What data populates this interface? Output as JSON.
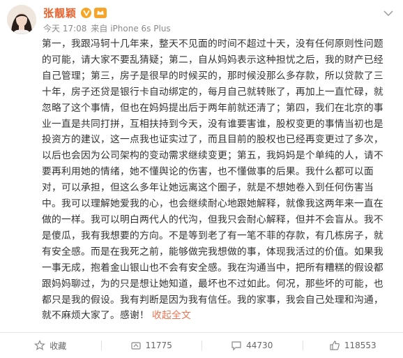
{
  "post": {
    "author": "张靓颖",
    "timestamp": "今天 17:08",
    "source": "来自 iPhone 6s Plus",
    "text": "第一，我跟冯轲十几年来，整天不见面的时间不超过十天，没有任何原则性问题的可能，请大家不要乱猜疑；第二，自从妈妈表示这种担忧之后，我的财产已经自己管理；第三，房子是很早的时候买的，那时候没那么多存款，所以贷款了三十年，房子还贷是银行卡自动绑定的，每月自己就转账了，再加上一直忙碌，就忽略了这个事情，但也在妈妈提出后于两年前就还清了；第四，我们在北京的事业一直是共同打拼，互相扶持到今天，没有谁要害谁，股权变更的事情当初也是投资方的建议，这一点我也证实过了，而且目前的股权也已经再变更过了多次，以后也会因为公司架构的变动需求继续变更；第五，我妈妈是个单纯的人，请不要再利用她的情绪，她不懂舆论的伤害，也不懂做事的后果。我什么都可以面对，可以承担，但这么多年让她远离这个圈子，就是不想她卷入到任何伤害当中。我可以理解她爱我的心，也会继续耐心地跟她解释，就像我这两年来一直在做的一样。我可以明白两代人的代沟，但我只会耐心解释，但并不会盲从。我不是傻瓜，我有我想要的方向。不是等到老了有一笔不菲的存款，有几栋房子，就有安全感。而是在我死之前，能够做完我想做的事，体现我活过的价值。如果我一事无成，抱着金山银山也不会有安全感。我在沟通当中，把所有糟糕的假设都跟妈妈聊过，为的只是想让她知道，最坏也不过如此。何况，那些坏的可能，也都只是我的假设。我有判断是因为我有信任。我的家事，我会自己处理和沟通，就不麻烦大家了。感谢！",
    "collapse_label": "收起全文"
  },
  "actions": {
    "favorite_label": "收藏",
    "repost_count": "11775",
    "comment_count": "44730",
    "like_count": "118553"
  },
  "colors": {
    "name": "#e8612c",
    "link": "#eb7350",
    "meta": "#8a8a8a",
    "vip": "#f6a623"
  },
  "icons": {
    "verified": "vip-badge-icon",
    "level": "level-badge-icon",
    "menu": "chevron-down-icon",
    "favorite": "star-icon",
    "repost": "repost-icon",
    "comment": "comment-icon",
    "like": "thumbs-up-icon"
  }
}
